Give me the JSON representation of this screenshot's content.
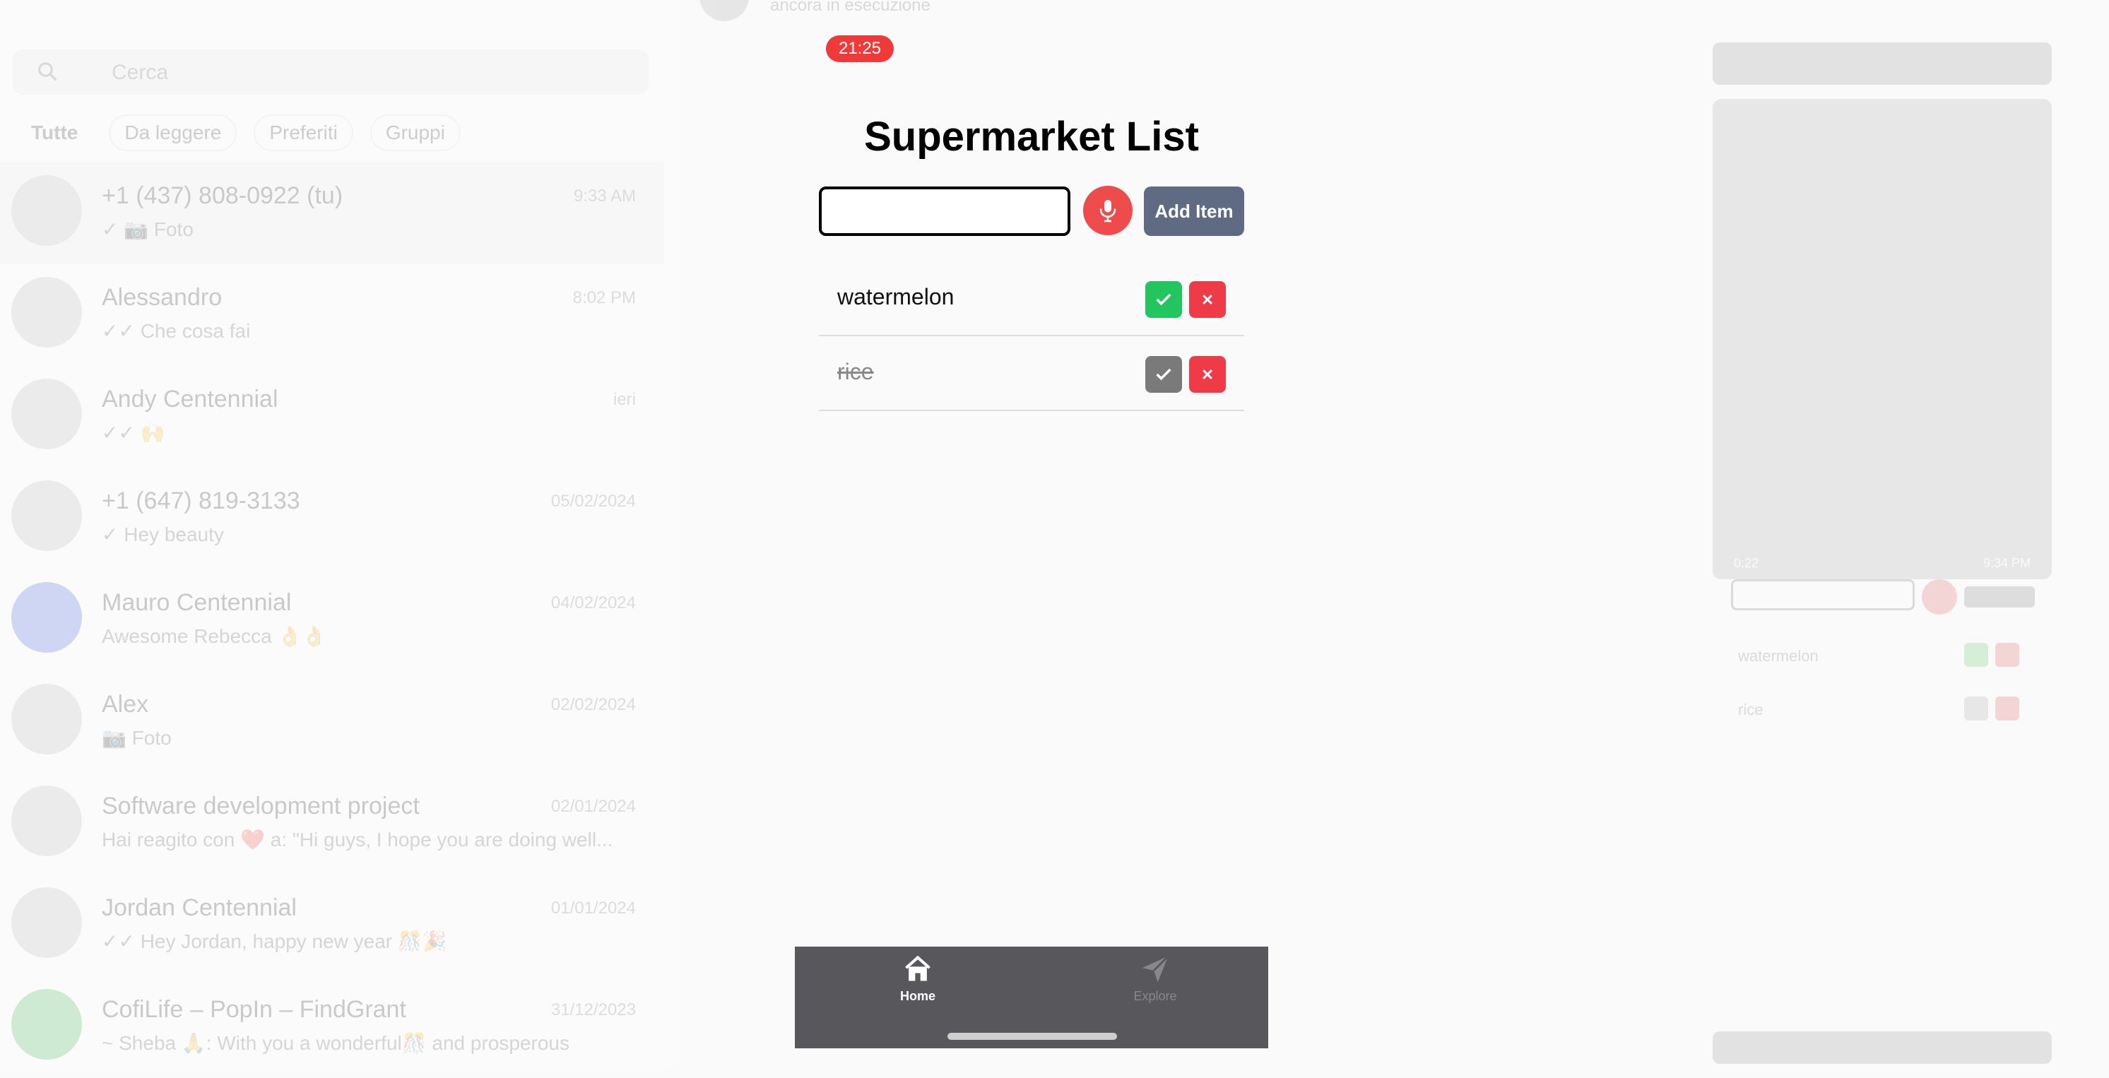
{
  "background": {
    "search_placeholder": "Cerca",
    "filters": [
      "Tutte",
      "Da leggere",
      "Preferiti",
      "Gruppi"
    ],
    "chats": [
      {
        "name": "+1 (437) 808-0922 (tu)",
        "preview": "✓ 📷 Foto",
        "time": "9:33 AM"
      },
      {
        "name": "Alessandro",
        "preview": "✓✓ Che cosa fai",
        "time": "8:02 PM"
      },
      {
        "name": "Andy Centennial",
        "preview": "✓✓ 🙌",
        "time": "ieri"
      },
      {
        "name": "+1 (647) 819-3133",
        "preview": "✓ Hey beauty",
        "time": "05/02/2024"
      },
      {
        "name": "Mauro Centennial",
        "preview": "Awesome Rebecca 👌👌",
        "time": "04/02/2024"
      },
      {
        "name": "Alex",
        "preview": "📷 Foto",
        "time": "02/02/2024"
      },
      {
        "name": "Software development project",
        "preview": "Hai reagito con ❤️ a: \"Hi guys, I hope you are doing well...",
        "time": "02/01/2024"
      },
      {
        "name": "Jordan Centennial",
        "preview": "✓✓ Hey Jordan, happy new year 🎊🎉",
        "time": "01/01/2024"
      },
      {
        "name": "CofiLife – PopIn – FindGrant",
        "preview": "~ Sheba 🙏: With you a wonderful🎊 and prosperous",
        "time": "31/12/2023"
      }
    ],
    "top_strip_text": "ancora in esecuzione",
    "right_pane": {
      "items": [
        "watermelon",
        "rice"
      ],
      "video_time_left": "0:22",
      "video_time_right": "9:34 PM"
    }
  },
  "app": {
    "status_time": "21:25",
    "title": "Supermarket List",
    "input": {
      "value": "",
      "placeholder": ""
    },
    "add_button_label": "Add Item",
    "items": [
      {
        "label": "watermelon",
        "done": false
      },
      {
        "label": "rice",
        "done": true
      }
    ],
    "tabs": [
      {
        "label": "Home",
        "icon": "home-icon",
        "active": true
      },
      {
        "label": "Explore",
        "icon": "paper-plane-icon",
        "active": false
      }
    ],
    "colors": {
      "mic": "#ee4c4c",
      "add_button": "#5f6b83",
      "check_active": "#23c55e",
      "check_done": "#7a7a7a",
      "delete": "#ee3b47",
      "tabbar": "#58585c",
      "status_pill": "#ef3a3a"
    }
  }
}
